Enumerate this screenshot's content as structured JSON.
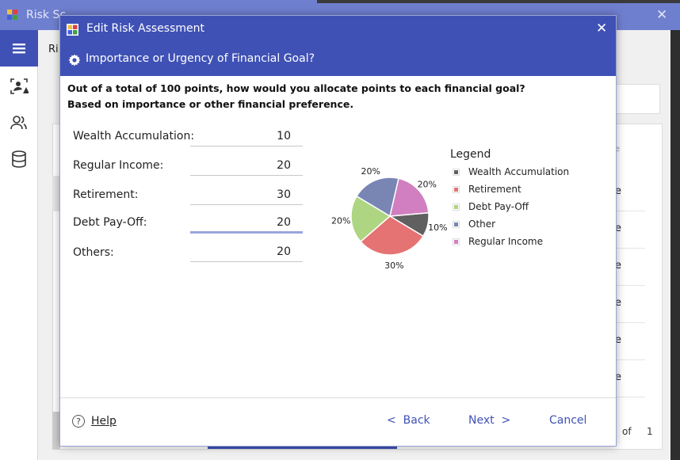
{
  "background_app": {
    "title": "Risk Sc",
    "tab_label": "Ri",
    "list_rows": [
      "e",
      "e",
      "e",
      "e",
      "e",
      "e"
    ],
    "header_cell": "e",
    "pager_of": "of",
    "pager_total": "1"
  },
  "dialog": {
    "title": "Edit Risk Assessment",
    "subheader": "Importance or Urgency of Financial Goal?",
    "question_line1": "Out of a total of 100 points, how would you allocate points to each financial goal?",
    "question_line2": "Based on importance or other financial preference.",
    "fields": [
      {
        "label": "Wealth Accumulation:",
        "value": "10"
      },
      {
        "label": "Regular Income:",
        "value": "20"
      },
      {
        "label": "Retirement:",
        "value": "30"
      },
      {
        "label": "Debt Pay-Off:",
        "value": "20"
      },
      {
        "label": "Others:",
        "value": "20"
      }
    ],
    "footer": {
      "help_label": "Help",
      "back_label": "<  Back",
      "next_label": "Next  >",
      "cancel_label": "Cancel"
    }
  },
  "chart_data": {
    "type": "pie",
    "legend_title": "Legend",
    "slices": [
      {
        "name": "Wealth Accumulation",
        "value": 10,
        "label": "10%",
        "color": "#606060"
      },
      {
        "name": "Retirement",
        "value": 30,
        "label": "30%",
        "color": "#e57373"
      },
      {
        "name": "Debt Pay-Off",
        "value": 20,
        "label": "20%",
        "color": "#aed581"
      },
      {
        "name": "Other",
        "value": 20,
        "label": "20%",
        "color": "#7986b4"
      },
      {
        "name": "Regular Income",
        "value": 20,
        "label": "20%",
        "color": "#d17fc0"
      }
    ],
    "legend_placement": "right"
  },
  "colors": {
    "accent": "#3f51b5"
  }
}
